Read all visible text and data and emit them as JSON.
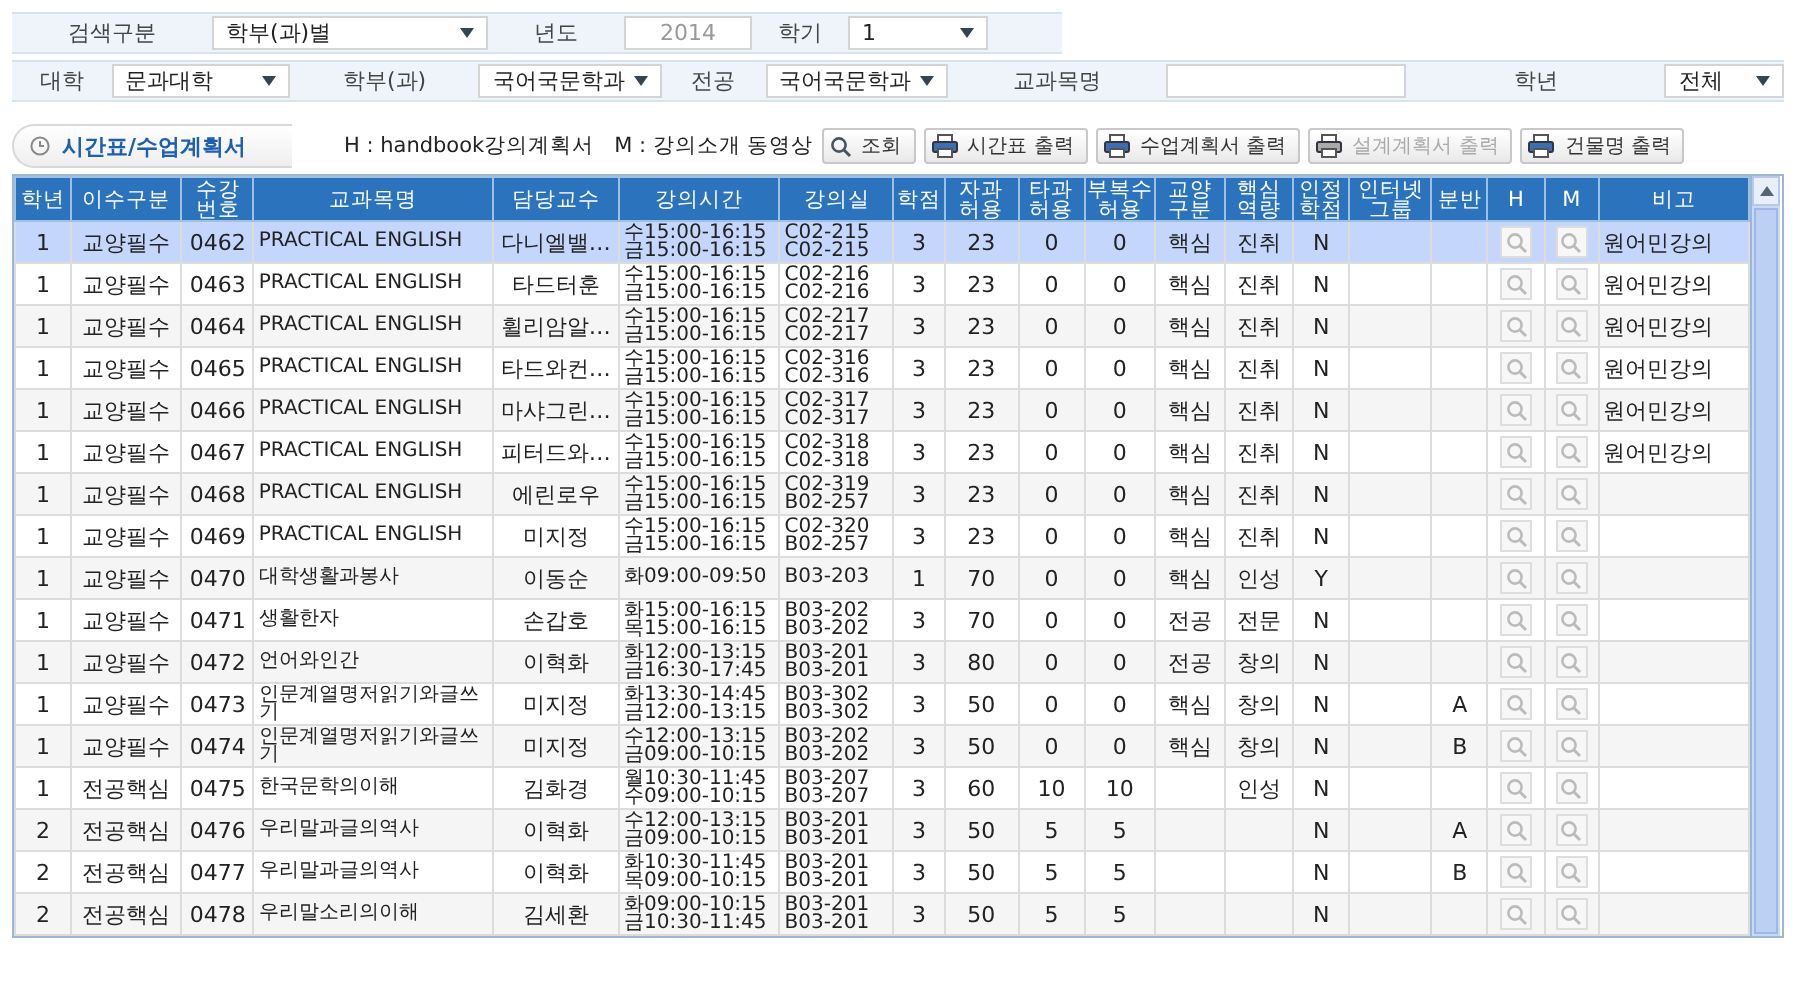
{
  "filters": {
    "row1": [
      {
        "label": "검색구분",
        "kind": "select",
        "value": "학부(과)별"
      },
      {
        "label": "년도",
        "kind": "readonly",
        "value": "2014"
      },
      {
        "label": "학기",
        "kind": "select",
        "value": "1"
      }
    ],
    "row2": [
      {
        "label": "대학",
        "kind": "select",
        "value": "문과대학"
      },
      {
        "label": "학부(과)",
        "kind": "select",
        "value": "국어국문학과"
      },
      {
        "label": "전공",
        "kind": "select",
        "value": "국어국문학과"
      },
      {
        "label": "교과목명",
        "kind": "input"
      },
      {
        "label": "학년",
        "kind": "select",
        "value": "전체"
      }
    ]
  },
  "section": {
    "title": "시간표/수업계획서",
    "legend": "H : handbook강의계획서   M : 강의소개 동영상",
    "buttons": [
      {
        "label": "조회",
        "kind": "search",
        "disabled": false
      },
      {
        "label": "시간표 출력",
        "kind": "print",
        "disabled": false
      },
      {
        "label": "수업계획서 출력",
        "kind": "print",
        "disabled": false
      },
      {
        "label": "설계계획서 출력",
        "kind": "print",
        "disabled": true
      },
      {
        "label": "건물명 출력",
        "kind": "print",
        "disabled": false
      }
    ]
  },
  "table": {
    "columns": [
      "학년",
      "이수구분",
      "수강 번호",
      "교과목명",
      "담당교수",
      "강의시간",
      "강의실",
      "학점",
      "자과 허용",
      "타과 허용",
      "부복수 허용",
      "교양 구분",
      "핵심 역량",
      "인정 학점",
      "인터넷 그룹",
      "분반",
      "H",
      "M",
      "비고"
    ],
    "rows": [
      {
        "selected": true,
        "year": "1",
        "type": "교양필수",
        "number": "0462",
        "title": "PRACTICAL ENGLISH",
        "professor": "다니엘밸…",
        "times": [
          "수15:00-16:15",
          "금15:00-16:15"
        ],
        "rooms": [
          "C02-215",
          "C02-215"
        ],
        "credits": "3",
        "own": "23",
        "other": "0",
        "double": "0",
        "general": "핵심",
        "competency": "진취",
        "recognized": "N",
        "note": "원어민강의"
      },
      {
        "selected": false,
        "year": "1",
        "type": "교양필수",
        "number": "0463",
        "title": "PRACTICAL ENGLISH",
        "professor": "타드터훈",
        "times": [
          "수15:00-16:15",
          "금15:00-16:15"
        ],
        "rooms": [
          "C02-216",
          "C02-216"
        ],
        "credits": "3",
        "own": "23",
        "other": "0",
        "double": "0",
        "general": "핵심",
        "competency": "진취",
        "recognized": "N",
        "note": "원어민강의"
      },
      {
        "selected": false,
        "year": "1",
        "type": "교양필수",
        "number": "0464",
        "title": "PRACTICAL ENGLISH",
        "professor": "휠리암알…",
        "times": [
          "수15:00-16:15",
          "금15:00-16:15"
        ],
        "rooms": [
          "C02-217",
          "C02-217"
        ],
        "credits": "3",
        "own": "23",
        "other": "0",
        "double": "0",
        "general": "핵심",
        "competency": "진취",
        "recognized": "N",
        "note": "원어민강의"
      },
      {
        "selected": false,
        "year": "1",
        "type": "교양필수",
        "number": "0465",
        "title": "PRACTICAL ENGLISH",
        "professor": "타드와컨…",
        "times": [
          "수15:00-16:15",
          "금15:00-16:15"
        ],
        "rooms": [
          "C02-316",
          "C02-316"
        ],
        "credits": "3",
        "own": "23",
        "other": "0",
        "double": "0",
        "general": "핵심",
        "competency": "진취",
        "recognized": "N",
        "note": "원어민강의"
      },
      {
        "selected": false,
        "year": "1",
        "type": "교양필수",
        "number": "0466",
        "title": "PRACTICAL ENGLISH",
        "professor": "마샤그린…",
        "times": [
          "수15:00-16:15",
          "금15:00-16:15"
        ],
        "rooms": [
          "C02-317",
          "C02-317"
        ],
        "credits": "3",
        "own": "23",
        "other": "0",
        "double": "0",
        "general": "핵심",
        "competency": "진취",
        "recognized": "N",
        "note": "원어민강의"
      },
      {
        "selected": false,
        "year": "1",
        "type": "교양필수",
        "number": "0467",
        "title": "PRACTICAL ENGLISH",
        "professor": "피터드와…",
        "times": [
          "수15:00-16:15",
          "금15:00-16:15"
        ],
        "rooms": [
          "C02-318",
          "C02-318"
        ],
        "credits": "3",
        "own": "23",
        "other": "0",
        "double": "0",
        "general": "핵심",
        "competency": "진취",
        "recognized": "N",
        "note": "원어민강의"
      },
      {
        "selected": false,
        "year": "1",
        "type": "교양필수",
        "number": "0468",
        "title": "PRACTICAL ENGLISH",
        "professor": "에린로우",
        "times": [
          "수15:00-16:15",
          "금15:00-16:15"
        ],
        "rooms": [
          "C02-319",
          "B02-257"
        ],
        "credits": "3",
        "own": "23",
        "other": "0",
        "double": "0",
        "general": "핵심",
        "competency": "진취",
        "recognized": "N"
      },
      {
        "selected": false,
        "year": "1",
        "type": "교양필수",
        "number": "0469",
        "title": "PRACTICAL ENGLISH",
        "professor": "미지정",
        "times": [
          "수15:00-16:15",
          "금15:00-16:15"
        ],
        "rooms": [
          "C02-320",
          "B02-257"
        ],
        "credits": "3",
        "own": "23",
        "other": "0",
        "double": "0",
        "general": "핵심",
        "competency": "진취",
        "recognized": "N"
      },
      {
        "selected": false,
        "year": "1",
        "type": "교양필수",
        "number": "0470",
        "title": "대학생활과봉사",
        "professor": "이동순",
        "times": [
          "화09:00-09:50"
        ],
        "rooms": [
          "B03-203"
        ],
        "credits": "1",
        "own": "70",
        "other": "0",
        "double": "0",
        "general": "핵심",
        "competency": "인성",
        "recognized": "Y"
      },
      {
        "selected": false,
        "year": "1",
        "type": "교양필수",
        "number": "0471",
        "title": "생활한자",
        "professor": "손갑호",
        "times": [
          "화15:00-16:15",
          "목15:00-16:15"
        ],
        "rooms": [
          "B03-202",
          "B03-202"
        ],
        "credits": "3",
        "own": "70",
        "other": "0",
        "double": "0",
        "general": "전공",
        "competency": "전문",
        "recognized": "N"
      },
      {
        "selected": false,
        "year": "1",
        "type": "교양필수",
        "number": "0472",
        "title": "언어와인간",
        "professor": "이혁화",
        "times": [
          "화12:00-13:15",
          "금16:30-17:45"
        ],
        "rooms": [
          "B03-201",
          "B03-201"
        ],
        "credits": "3",
        "own": "80",
        "other": "0",
        "double": "0",
        "general": "전공",
        "competency": "창의",
        "recognized": "N"
      },
      {
        "selected": false,
        "year": "1",
        "type": "교양필수",
        "number": "0473",
        "title": "인문계열명저읽기와글쓰기",
        "professor": "미지정",
        "times": [
          "화13:30-14:45",
          "금12:00-13:15"
        ],
        "rooms": [
          "B03-302",
          "B03-302"
        ],
        "credits": "3",
        "own": "50",
        "other": "0",
        "double": "0",
        "general": "핵심",
        "competency": "창의",
        "recognized": "N",
        "section": "A"
      },
      {
        "selected": false,
        "year": "1",
        "type": "교양필수",
        "number": "0474",
        "title": "인문계열명저읽기와글쓰기",
        "professor": "미지정",
        "times": [
          "수12:00-13:15",
          "금09:00-10:15"
        ],
        "rooms": [
          "B03-202",
          "B03-202"
        ],
        "credits": "3",
        "own": "50",
        "other": "0",
        "double": "0",
        "general": "핵심",
        "competency": "창의",
        "recognized": "N",
        "section": "B"
      },
      {
        "selected": false,
        "year": "1",
        "type": "전공핵심",
        "number": "0475",
        "title": "한국문학의이해",
        "professor": "김화경",
        "times": [
          "월10:30-11:45",
          "수09:00-10:15"
        ],
        "rooms": [
          "B03-207",
          "B03-207"
        ],
        "credits": "3",
        "own": "60",
        "other": "10",
        "double": "10",
        "competency": "인성",
        "recognized": "N"
      },
      {
        "selected": false,
        "year": "2",
        "type": "전공핵심",
        "number": "0476",
        "title": "우리말과글의역사",
        "professor": "이혁화",
        "times": [
          "수12:00-13:15",
          "금09:00-10:15"
        ],
        "rooms": [
          "B03-201",
          "B03-201"
        ],
        "credits": "3",
        "own": "50",
        "other": "5",
        "double": "5",
        "recognized": "N",
        "section": "A"
      },
      {
        "selected": false,
        "year": "2",
        "type": "전공핵심",
        "number": "0477",
        "title": "우리말과글의역사",
        "professor": "이혁화",
        "times": [
          "화10:30-11:45",
          "목09:00-10:15"
        ],
        "rooms": [
          "B03-201",
          "B03-201"
        ],
        "credits": "3",
        "own": "50",
        "other": "5",
        "double": "5",
        "recognized": "N",
        "section": "B"
      },
      {
        "selected": false,
        "year": "2",
        "type": "전공핵심",
        "number": "0478",
        "title": "우리말소리의이해",
        "professor": "김세환",
        "times": [
          "화09:00-10:15",
          "금10:30-11:45"
        ],
        "rooms": [
          "B03-201",
          "B03-201"
        ],
        "credits": "3",
        "own": "50",
        "other": "5",
        "double": "5",
        "recognized": "N"
      }
    ]
  }
}
